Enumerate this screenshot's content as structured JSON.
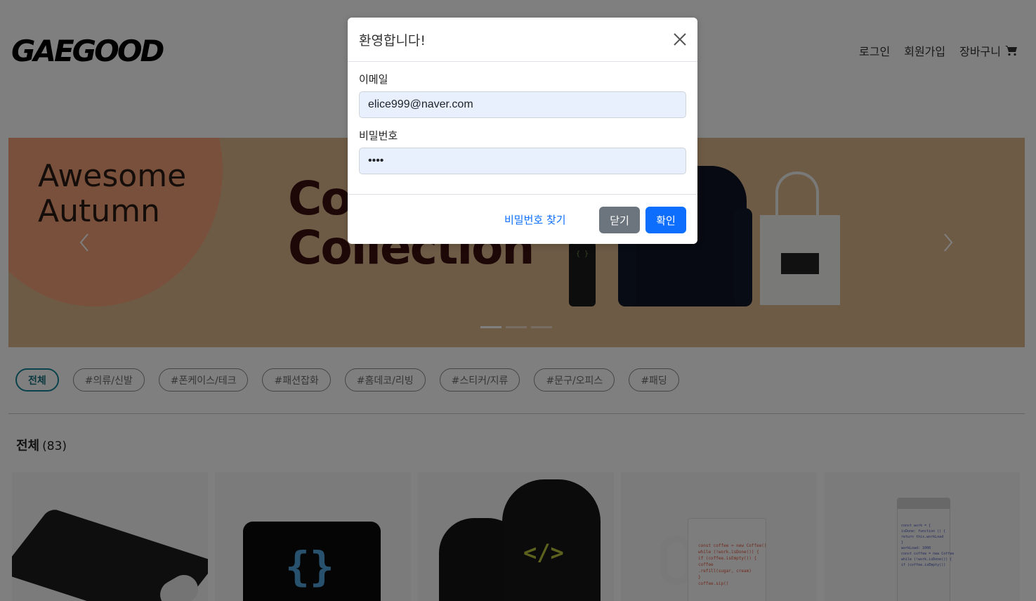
{
  "header": {
    "logo": "GAEGOOD",
    "nav": {
      "login": "로그인",
      "signup": "회원가입",
      "cart": "장바구니"
    }
  },
  "banner": {
    "left_text": "Awesome\nAutumn",
    "center_text": "Collection",
    "center_text_visible_prefix": "Co",
    "bottle_logo": "{ }",
    "active_slide": 1,
    "slide_count": 3
  },
  "tags": [
    "전체",
    "#의류/신발",
    "#폰케이스/테크",
    "#패션잡화",
    "#홈데코/리빙",
    "#스티커/지류",
    "#문구/오피스",
    "#패딩"
  ],
  "section": {
    "title": "전체",
    "count": "(83)"
  },
  "products": {
    "p2_logo": "{}",
    "p3_logo": "</>",
    "p4_code": "const coffee = new Coffee()\nwhile (!work.isDone()) {\nif (coffee.isEmpty()) {\ncoffee\n.refill(sugar, cream)\n}\ncoffee.sip()",
    "p5_code": "const work = {\nisDone: function () {\nreturn this.workLoad\n}\nworkLoad: 1000\nconst coffee = new Coffee\nwhile (!work.isDone()) {\nif (coffee.isEmpty())"
  },
  "modal": {
    "title": "환영합니다!",
    "email_label": "이메일",
    "email_value": "elice999@naver.com",
    "password_label": "비밀번호",
    "password_value": "1234",
    "find_password": "비밀번호 찾기",
    "close_label": "닫기",
    "confirm_label": "확인"
  },
  "colors": {
    "accent": "#0d6efd",
    "secondary": "#6c757d",
    "active_tag": "#138496",
    "banner_bg": "#dcb68c",
    "banner_circle": "#f1a176"
  }
}
